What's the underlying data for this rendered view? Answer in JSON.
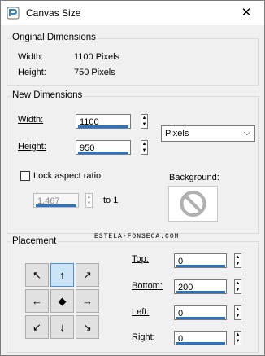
{
  "window": {
    "title": "Canvas Size"
  },
  "original": {
    "group_title": "Original Dimensions",
    "width_label": "Width:",
    "width_value": "1100 Pixels",
    "height_label": "Height:",
    "height_value": "750 Pixels"
  },
  "new_dims": {
    "group_title": "New Dimensions",
    "width_label": "Width:",
    "width_value": "1100",
    "height_label": "Height:",
    "height_value": "950",
    "units": "Pixels",
    "lock_label": "Lock aspect ratio:",
    "ratio_value": "1,467",
    "ratio_suffix": "to 1",
    "background_label": "Background:"
  },
  "placement": {
    "group_title": "Placement",
    "top_label": "Top:",
    "top_value": "0",
    "bottom_label": "Bottom:",
    "bottom_value": "200",
    "left_label": "Left:",
    "left_value": "0",
    "right_label": "Right:",
    "right_value": "0",
    "grid_icons": [
      "arrow-nw-icon",
      "arrow-up-icon",
      "arrow-ne-icon",
      "arrow-left-icon",
      "center-dot-icon",
      "arrow-right-icon",
      "arrow-sw-icon",
      "arrow-down-icon",
      "arrow-se-icon"
    ],
    "selected_position": "top-center"
  },
  "watermark": "ESTELA-FONSECA.COM",
  "colors": {
    "accent": "#2d73c5",
    "selected": "#cce4f7"
  }
}
